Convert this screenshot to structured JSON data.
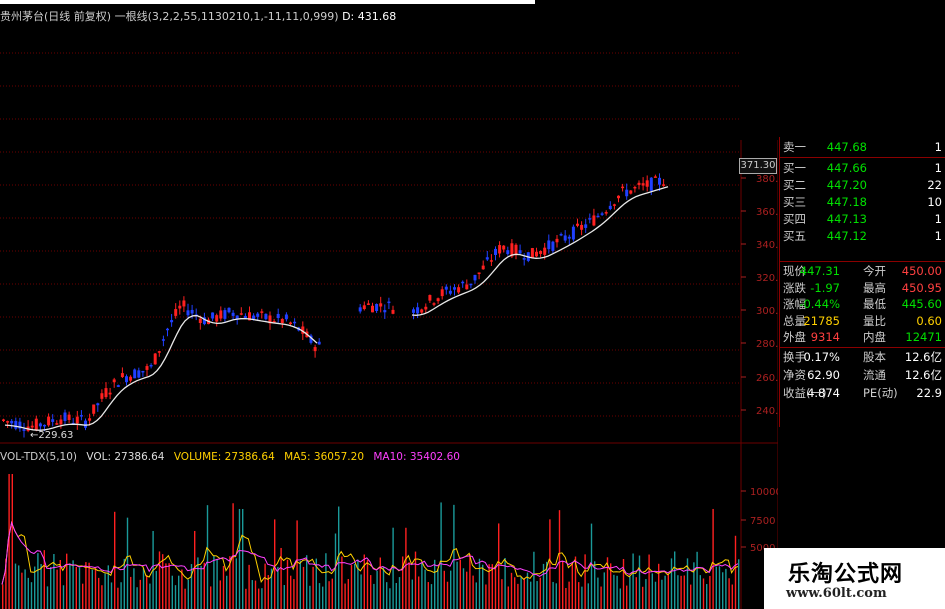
{
  "header": {
    "title": "贵州茅台(日线 前复权) 一根线(3,2,2,55,1130210,1,-11,11,0,999)",
    "d_label": "D: 431.68"
  },
  "price_axis": {
    "ticks": [
      "380.0",
      "360.0",
      "340.0",
      "320.0",
      "300.0",
      "280.0",
      "260.0",
      "240.0"
    ],
    "current_price_tag": "371.30",
    "low_marker": "229.63"
  },
  "volume_header": {
    "name": "VOL-TDX(5,10)",
    "vol": "VOL: 27386.64",
    "volume": "VOLUME: 27386.64",
    "ma5": "MA5: 36057.20",
    "ma10": "MA10: 35402.60"
  },
  "volume_axis": {
    "ticks": [
      "10000",
      "7500",
      "5000"
    ]
  },
  "quote": {
    "sell1": {
      "label": "卖一",
      "price": "447.68",
      "qty": "1"
    },
    "buys": [
      {
        "label": "买一",
        "price": "447.66",
        "qty": "1"
      },
      {
        "label": "买二",
        "price": "447.20",
        "qty": "22"
      },
      {
        "label": "买三",
        "price": "447.18",
        "qty": "10"
      },
      {
        "label": "买四",
        "price": "447.13",
        "qty": "1"
      },
      {
        "label": "买五",
        "price": "447.12",
        "qty": "1"
      }
    ],
    "stats": [
      {
        "l1": "现价",
        "v1": "447.31",
        "c1": "green",
        "l2": "今开",
        "v2": "450.00",
        "c2": "red"
      },
      {
        "l1": "涨跌",
        "v1": "-1.97",
        "c1": "green",
        "l2": "最高",
        "v2": "450.95",
        "c2": "red"
      },
      {
        "l1": "涨幅",
        "v1": "-0.44%",
        "c1": "green",
        "l2": "最低",
        "v2": "445.60",
        "c2": "green"
      },
      {
        "l1": "总量",
        "v1": "21785",
        "c1": "yellow",
        "l2": "量比",
        "v2": "0.60",
        "c2": "yellow"
      },
      {
        "l1": "外盘",
        "v1": "9314",
        "c1": "red",
        "l2": "内盘",
        "v2": "12471",
        "c2": "green"
      }
    ],
    "fundamentals": [
      {
        "l1": "换手",
        "v1": "0.17%",
        "l2": "股本",
        "v2": "12.6亿"
      },
      {
        "l1": "净资",
        "v1": "62.90",
        "l2": "流通",
        "v2": "12.6亿"
      }
    ],
    "pe_row": {
      "l1": "收益(一)",
      "v1": "4.874",
      "l2": "PE(动)",
      "v2": "22.9"
    }
  },
  "watermark": {
    "title": "乐淘公式网",
    "url": "www.60lt.com"
  },
  "colors": {
    "up": "#ff2020",
    "down": "#2040ff",
    "ma": "#e8e8e8",
    "grid": "#6b0000"
  }
}
